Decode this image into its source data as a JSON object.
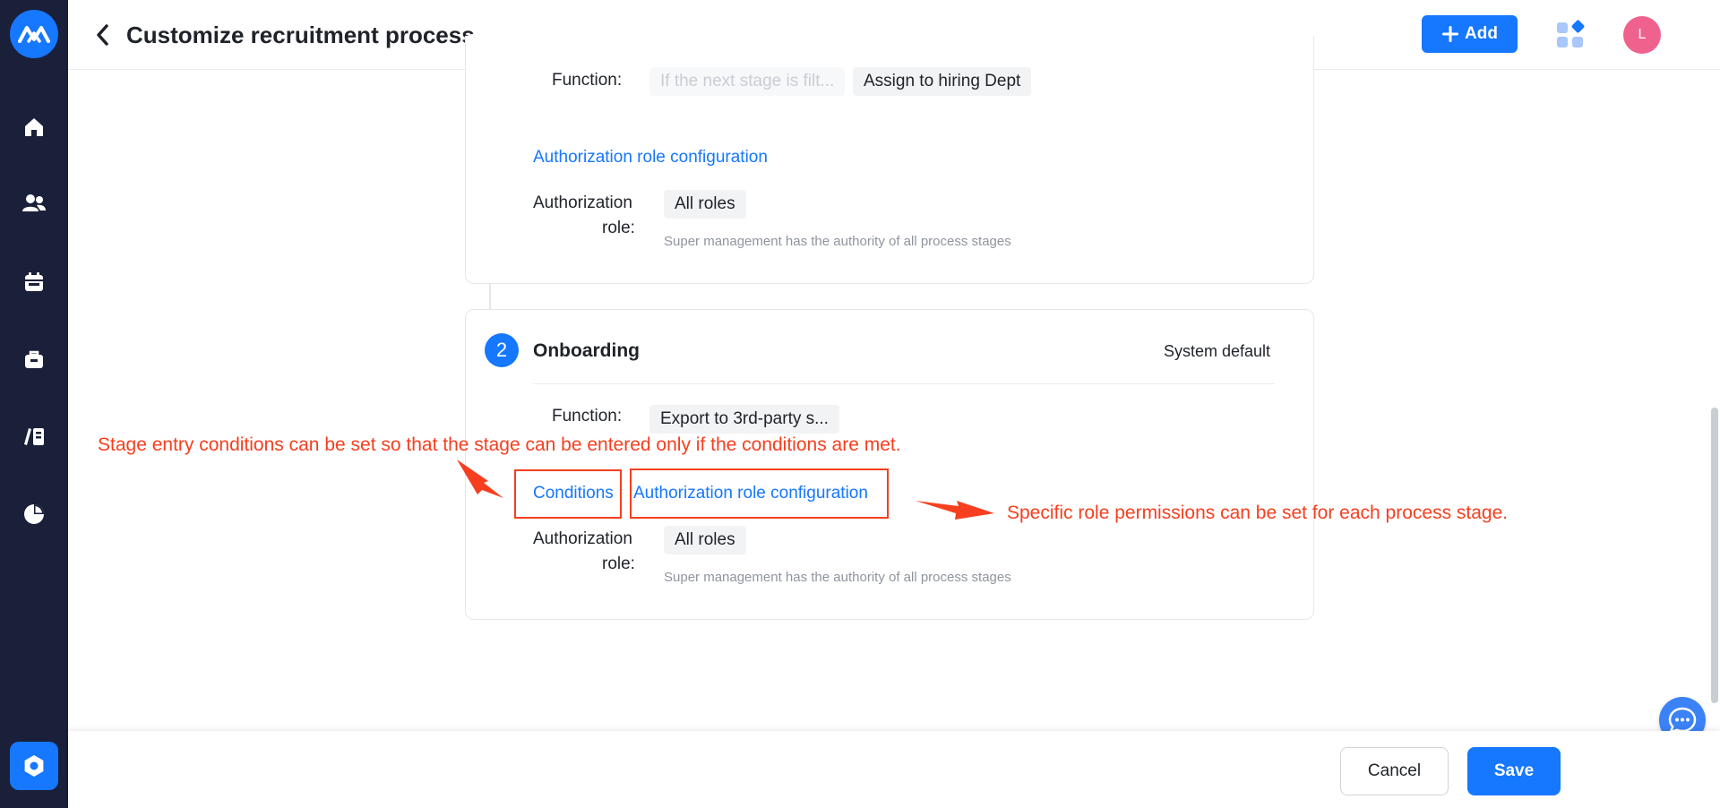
{
  "header": {
    "title": "Customize recruitment process",
    "add_label": "Add",
    "avatar_initial": "L"
  },
  "stage1": {
    "function_label": "Function:",
    "function_tag_disabled": "If the next stage is filt...",
    "function_tag": "Assign to hiring Dept",
    "auth_config_link": "Authorization role configuration",
    "auth_role_label_1": "Authorization",
    "auth_role_label_2": "role:",
    "auth_role_tag": "All roles",
    "auth_hint": "Super management has the authority of all process stages"
  },
  "stage2": {
    "number": "2",
    "title": "Onboarding",
    "status": "System default",
    "function_label": "Function:",
    "function_tag": "Export to 3rd-party s...",
    "conditions_link": "Conditions",
    "auth_config_link": "Authorization role configuration",
    "auth_role_label_1": "Authorization",
    "auth_role_label_2": "role:",
    "auth_role_tag": "All roles",
    "auth_hint": "Super management has the authority of all process stages"
  },
  "annotations": {
    "left": "Stage entry conditions can be set so that the stage can be entered only if the conditions are met.",
    "right": "Specific role permissions can be set for each process stage.",
    "color": "#f53f1f"
  },
  "footer": {
    "cancel_label": "Cancel",
    "save_label": "Save"
  },
  "colors": {
    "sidebar": "#1a1f3a",
    "primary": "#1677ff",
    "avatar": "#f0628e"
  },
  "icons": {
    "sidebar": [
      "home-icon",
      "users-icon",
      "calendar-icon",
      "briefcase-icon",
      "library-icon",
      "pie-chart-icon",
      "settings-icon"
    ]
  }
}
